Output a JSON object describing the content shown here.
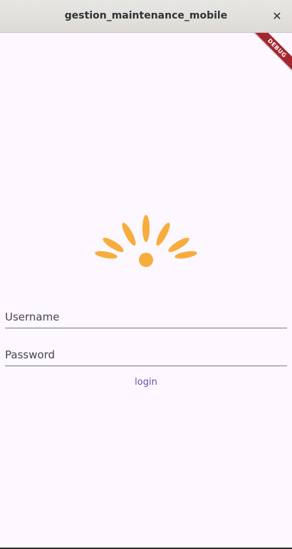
{
  "window": {
    "title": "gestion_maintenance_mobile",
    "close_glyph": "✕"
  },
  "debug_banner": {
    "label": "DEBUG"
  },
  "logo": {
    "icon": "sun-rays-logo-icon",
    "color": "#f7ad3c"
  },
  "form": {
    "username_placeholder": "Username",
    "password_placeholder": "Password",
    "login_label": "login"
  },
  "colors": {
    "background": "#fdf7ff",
    "accent": "#6750a4",
    "banner": "#a3262c"
  }
}
